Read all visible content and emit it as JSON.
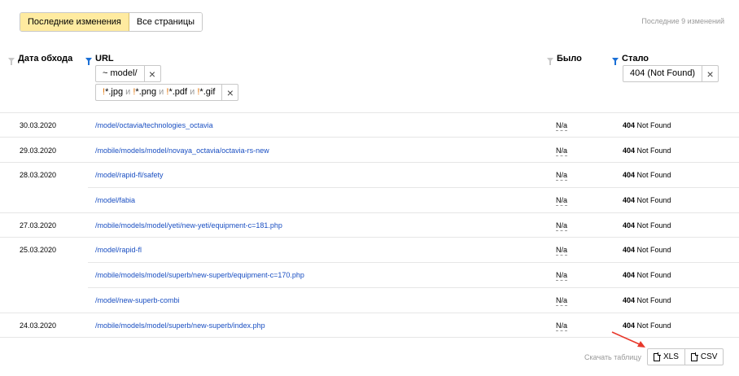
{
  "tabs": {
    "recent_label": "Последние изменения",
    "all_label": "Все страницы"
  },
  "changes_count": "Последние 9 изменений",
  "columns": {
    "date": "Дата обхода",
    "url": "URL",
    "was": "Было",
    "became": "Стало"
  },
  "filters": {
    "url_filter_1": "~ model/",
    "url_filter_2": {
      "t1": "!",
      "t2": "*.jpg",
      "and1": " и ",
      "t3": "!",
      "t4": "*.png",
      "and2": " и ",
      "t5": "!",
      "t6": "*.pdf",
      "and3": " и ",
      "t7": "!",
      "t8": "*.gif"
    },
    "status_filter": "404 (Not Found)"
  },
  "rows": [
    {
      "date": "30.03.2020",
      "url": "/model/octavia/technologies_octavia",
      "was": "N/a",
      "code": "404",
      "status": " Not Found"
    },
    {
      "date": "29.03.2020",
      "url": "/mobile/models/model/novaya_octavia/octavia-rs-new",
      "was": "N/a",
      "code": "404",
      "status": " Not Found"
    },
    {
      "date": "28.03.2020",
      "url": "/model/rapid-fl/safety",
      "was": "N/a",
      "code": "404",
      "status": " Not Found"
    },
    {
      "date": "",
      "url": "/model/fabia",
      "was": "N/a",
      "code": "404",
      "status": " Not Found"
    },
    {
      "date": "27.03.2020",
      "url": "/mobile/models/model/yeti/new-yeti/equipment-c=181.php",
      "was": "N/a",
      "code": "404",
      "status": " Not Found"
    },
    {
      "date": "25.03.2020",
      "url": "/model/rapid-fl",
      "was": "N/a",
      "code": "404",
      "status": " Not Found"
    },
    {
      "date": "",
      "url": "/mobile/models/model/superb/new-superb/equipment-c=170.php",
      "was": "N/a",
      "code": "404",
      "status": " Not Found"
    },
    {
      "date": "",
      "url": "/model/new-superb-combi",
      "was": "N/a",
      "code": "404",
      "status": " Not Found"
    },
    {
      "date": "24.03.2020",
      "url": "/mobile/models/model/superb/new-superb/index.php",
      "was": "N/a",
      "code": "404",
      "status": " Not Found"
    }
  ],
  "download": {
    "label": "Скачать таблицу",
    "xls": "XLS",
    "csv": "CSV"
  },
  "colors": {
    "active_tab": "#ffeba0",
    "link": "#1a4fc2",
    "filter_active": "#1a6fd6",
    "annotation_arrow": "#e8382b"
  }
}
